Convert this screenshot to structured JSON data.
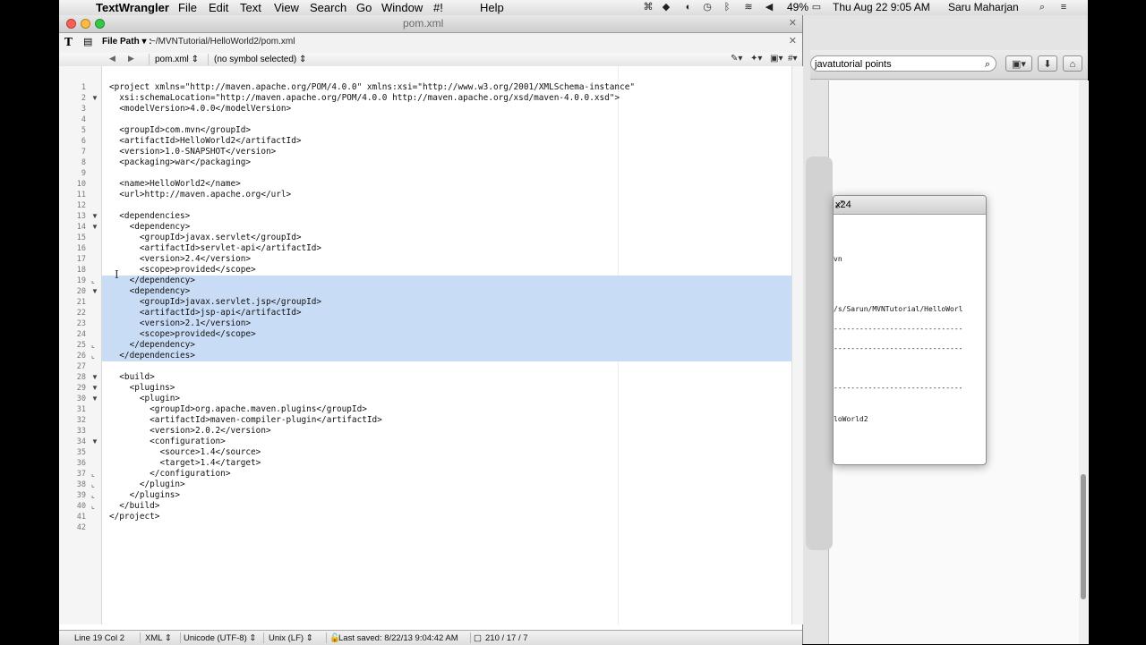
{
  "menubar": {
    "apple_icon": "apple-icon",
    "app_name": "TextWrangler",
    "menus": [
      "File",
      "Edit",
      "Text",
      "View",
      "Search",
      "Go",
      "Window",
      "#!",
      "Help"
    ],
    "battery": "49%",
    "datetime": "Thu Aug 22  9:05 AM",
    "user": "Saru Maharjan"
  },
  "editor": {
    "window_title": "pom.xml",
    "file_path_label": "File Path ▾ :",
    "file_path": "~/MVNTutorial/HelloWorld2/pom.xml",
    "nav_back": "◀",
    "nav_forward": "▶",
    "file_popup": "pom.xml",
    "symbol_popup": "(no symbol selected)",
    "lines": [
      "<project xmlns=\"http://maven.apache.org/POM/4.0.0\" xmlns:xsi=\"http://www.w3.org/2001/XMLSchema-instance\"",
      "  xsi:schemaLocation=\"http://maven.apache.org/POM/4.0.0 http://maven.apache.org/xsd/maven-4.0.0.xsd\">",
      "  <modelVersion>4.0.0</modelVersion>",
      "",
      "  <groupId>com.mvn</groupId>",
      "  <artifactId>HelloWorld2</artifactId>",
      "  <version>1.0-SNAPSHOT</version>",
      "  <packaging>war</packaging>",
      "",
      "  <name>HelloWorld2</name>",
      "  <url>http://maven.apache.org</url>",
      "",
      "  <dependencies>",
      "    <dependency>",
      "      <groupId>javax.servlet</groupId>",
      "      <artifactId>servlet-api</artifactId>",
      "      <version>2.4</version>",
      "      <scope>provided</scope>",
      "    </dependency>",
      "    <dependency>",
      "      <groupId>javax.servlet.jsp</groupId>",
      "      <artifactId>jsp-api</artifactId>",
      "      <version>2.1</version>",
      "      <scope>provided</scope>",
      "    </dependency>",
      "  </dependencies>",
      "",
      "  <build>",
      "    <plugins>",
      "      <plugin>",
      "        <groupId>org.apache.maven.plugins</groupId>",
      "        <artifactId>maven-compiler-plugin</artifactId>",
      "        <version>2.0.2</version>",
      "        <configuration>",
      "          <source>1.4</source>",
      "          <target>1.4</target>",
      "        </configuration>",
      "      </plugin>",
      "    </plugins>",
      "  </build>",
      "</project>",
      ""
    ],
    "fold_open_lines": [
      2,
      13,
      14,
      20,
      28,
      29,
      30,
      34
    ],
    "fold_close_lines": [
      19,
      25,
      26,
      37,
      38,
      39,
      40
    ],
    "selected_lines": [
      19,
      26
    ],
    "status": {
      "position": "Line 19 Col 2",
      "language": "XML",
      "encoding": "Unicode (UTF-8)",
      "line_endings": "Unix (LF)",
      "last_saved": "Last saved: 8/22/13 9:04:42 AM",
      "counts": "210 / 17 / 7"
    }
  },
  "background_window": {
    "search_value": "javatutorial points"
  },
  "terminal": {
    "title": "x24",
    "lines": [
      "vn",
      "/s/Sarun/MVNTutorial/HelloWorl",
      "------------------------------",
      "------------------------------",
      "------------------------------",
      "loWorld2"
    ]
  },
  "colors": {
    "selection": "#c9dcf5",
    "traffic_close": "#fc5d55",
    "traffic_min": "#fdbc40",
    "traffic_max": "#34c84a"
  }
}
